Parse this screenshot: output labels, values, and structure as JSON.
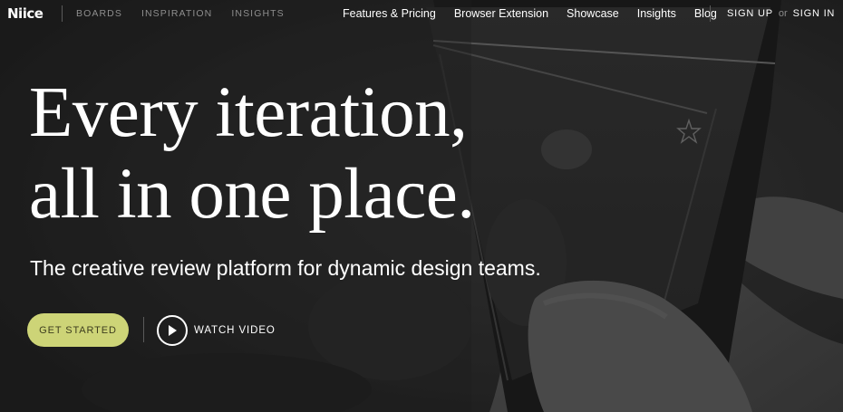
{
  "brand": {
    "logo_text": "Niice"
  },
  "nav": {
    "secondary": [
      {
        "label": "BOARDS"
      },
      {
        "label": "INSPIRATION"
      },
      {
        "label": "INSIGHTS"
      }
    ],
    "primary": [
      {
        "label": "Features & Pricing"
      },
      {
        "label": "Browser Extension"
      },
      {
        "label": "Showcase"
      },
      {
        "label": "Insights"
      },
      {
        "label": "Blog"
      }
    ],
    "auth": {
      "sign_up": "SIGN UP",
      "separator": "or",
      "sign_in": "SIGN IN"
    }
  },
  "hero": {
    "headline_line1": "Every iteration,",
    "headline_line2": "all in one place.",
    "subheadline": "The creative review platform for dynamic design teams."
  },
  "cta": {
    "get_started": "GET STARTED",
    "watch_video": "WATCH VIDEO"
  },
  "colors": {
    "background": "#222222",
    "accent_button": "#cdd477",
    "text": "#ffffff",
    "muted_nav": "#8e8e8e"
  },
  "icons": {
    "play": "play-icon",
    "star_on_screen": "star-icon"
  }
}
